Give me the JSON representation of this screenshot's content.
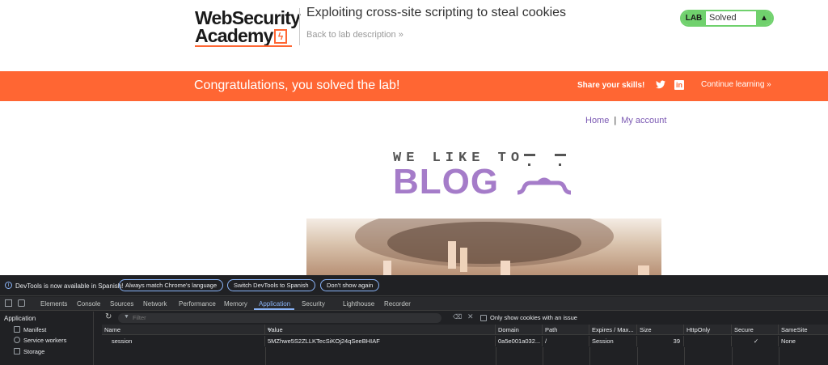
{
  "header": {
    "logo_line1": "WebSecurity",
    "logo_line2": "Academy",
    "lab_title": "Exploiting cross-site scripting to steal cookies",
    "back_link": "Back to lab description »",
    "lab_badge": "LAB",
    "lab_status": "Solved"
  },
  "banner": {
    "message": "Congratulations, you solved the lab!",
    "share": "Share your skills!",
    "continue": "Continue learning »"
  },
  "blog": {
    "nav_home": "Home",
    "nav_sep": "|",
    "nav_account": "My account",
    "logo_top": "WE LIKE TO",
    "logo_main": "BLOG"
  },
  "devtools": {
    "info_message": "DevTools is now available in Spanish!",
    "btn_match": "Always match Chrome's language",
    "btn_switch": "Switch DevTools to Spanish",
    "btn_dont": "Don't show again",
    "tabs": [
      "Elements",
      "Console",
      "Sources",
      "Network",
      "Performance",
      "Memory",
      "Application",
      "Security",
      "Lighthouse",
      "Recorder"
    ],
    "active_tab": "Application",
    "sidebar": {
      "heading": "Application",
      "items": [
        "Manifest",
        "Service workers",
        "Storage"
      ]
    },
    "filter_placeholder": "Filter",
    "only_issues_label": "Only show cookies with an issue",
    "table": {
      "headers": [
        "Name",
        "Value",
        "Domain",
        "Path",
        "Expires / Max...",
        "Size",
        "HttpOnly",
        "Secure",
        "SameSite"
      ],
      "rows": [
        {
          "name": "session",
          "value": "5MZhwe5S2ZLLKTecSiKOj24qSeeBHIAF",
          "domain": "0a5e001a032...",
          "path": "/",
          "expires": "Session",
          "size": "39",
          "httponly": "",
          "secure": "✓",
          "samesite": "None"
        }
      ]
    }
  },
  "colors": {
    "brand_orange": "#ff6633",
    "lab_green": "#70d16d",
    "blog_purple": "#a57cc9",
    "link_purple": "#7b59b3",
    "devtools_bg": "#202124",
    "devtools_accent": "#8ab4f8"
  }
}
